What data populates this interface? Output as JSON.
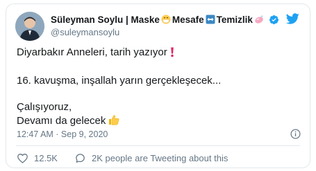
{
  "tweet": {
    "author_name": "Süleyman Soylu | Maske",
    "name_part2": "Mesafe",
    "name_part3": "Temizlik",
    "handle": "@suleymansoylu",
    "body": {
      "line1": "Diyarbakır Anneleri, tarih yazıyor",
      "line2": "16. kavuşma, inşallah yarın gerçekleşecek...",
      "line3": "Çalışıyoruz,",
      "line4": "Devamı da gelecek"
    },
    "timestamp": "12:47 AM · Sep 9, 2020",
    "likes": "12.5K",
    "tweeting_about": "2K people are Tweeting about this"
  },
  "icons": {
    "mask": "face-with-medical-mask-icon",
    "distance": "left-right-arrow-icon",
    "cleaning": "soap-icon",
    "verified": "verified-badge-icon",
    "brand": "twitter-bird-icon",
    "exclamation": "red-exclamation-icon",
    "thumbs_up": "thumbs-up-icon",
    "info": "info-icon",
    "like": "heart-icon",
    "comment": "speech-bubble-icon"
  },
  "colors": {
    "brand": "#1da1f2",
    "text": "#14171a",
    "muted": "#657786",
    "border": "#e1e8ed",
    "exclamation": "#e0245e"
  }
}
